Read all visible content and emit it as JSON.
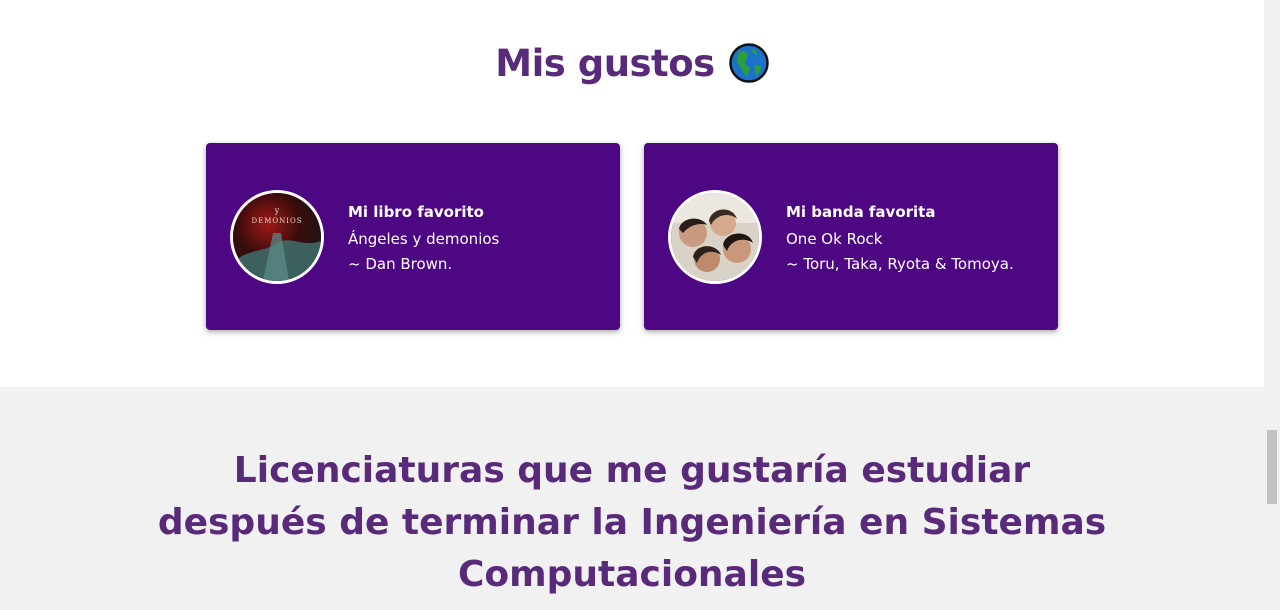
{
  "likes": {
    "title": "Mis gustos",
    "title_icon": "globe-americas-icon"
  },
  "cards": {
    "book": {
      "heading": "Mi libro favorito",
      "line1": "Ángeles y demonios",
      "line2": "~ Dan Brown.",
      "image": "book-cover-image",
      "cover_word1": "y",
      "cover_word2": "DEMONIOS"
    },
    "band": {
      "heading": "Mi banda favorita",
      "line1": "One Ok Rock",
      "line2": "~ Toru, Taka, Ryota & Tomoya.",
      "image": "band-photo-image"
    }
  },
  "career": {
    "title": "Licenciaturas que me gustaría estudiar después de terminar la Ingeniería en Sistemas Computacionales"
  },
  "colors": {
    "accent_text": "#5a2a7a",
    "card_bg": "#4e0783",
    "section_alt_bg": "#f1f1f2"
  }
}
